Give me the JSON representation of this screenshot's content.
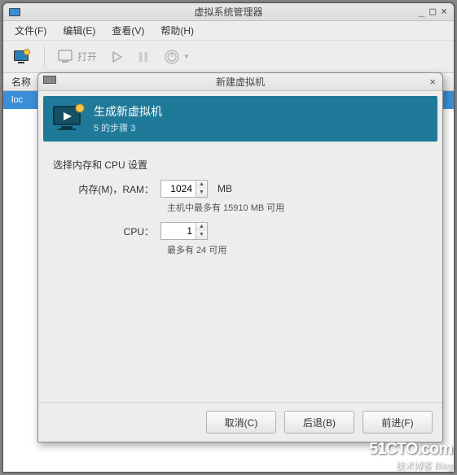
{
  "main": {
    "title": "虚拟系统管理器",
    "menu": {
      "file": "文件(F)",
      "edit": "编辑(E)",
      "view": "查看(V)",
      "help": "帮助(H)"
    },
    "toolbar": {
      "open": "打开"
    },
    "column_header": "名称",
    "list": {
      "row0": "loc"
    }
  },
  "dialog": {
    "title": "新建虚拟机",
    "banner": {
      "heading": "生成新虚拟机",
      "step": "5 的步骤 3"
    },
    "section_title": "选择内存和 CPU 设置",
    "ram": {
      "label": "内存(M)，RAM：",
      "value": "1024",
      "unit": "MB",
      "hint": "主机中最多有 15910 MB 可用"
    },
    "cpu": {
      "label": "CPU：",
      "value": "1",
      "hint": "最多有 24 可用"
    },
    "buttons": {
      "cancel": "取消(C)",
      "back": "后退(B)",
      "forward": "前进(F)"
    }
  },
  "watermark": {
    "line1": "51CTO.com",
    "line2": "技术博客  Blog"
  }
}
